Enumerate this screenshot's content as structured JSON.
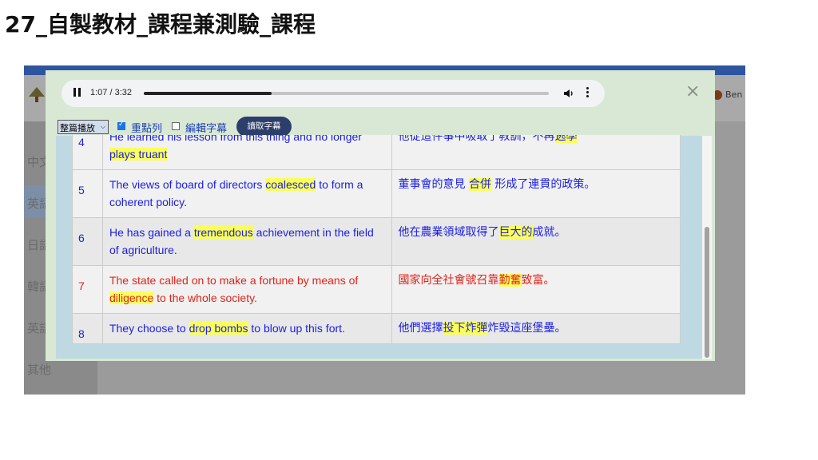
{
  "slide": {
    "title": "27_自製教材_課程兼測驗_課程"
  },
  "sidebar": {
    "items": [
      "中文",
      "英語",
      "日語",
      "韓語",
      "英語",
      "其他"
    ]
  },
  "header": {
    "user": "Ben"
  },
  "audio": {
    "time": "1:07 / 3:32",
    "progress": 0.316
  },
  "controls": {
    "select_value": "整篇播放",
    "repeat_label": "重點列",
    "repeat_checked": true,
    "edit_label": "編輯字幕",
    "edit_checked": false,
    "read_button": "讀取字幕"
  },
  "close_glyph": "×",
  "rows": [
    {
      "num": "4",
      "color": "blue",
      "shade": "b",
      "en": [
        {
          "t": "He learned his lesson from this thing and no longer "
        },
        {
          "t": "plays truant",
          "h": true
        }
      ],
      "zh": [
        {
          "t": "他從這件事中吸取了教訓，不再"
        },
        {
          "t": "逃學",
          "h": true
        }
      ]
    },
    {
      "num": "5",
      "color": "blue",
      "shade": "b",
      "en": [
        {
          "t": "The views of board of directors "
        },
        {
          "t": "coalesced",
          "h": true
        },
        {
          "t": " to form a coherent policy."
        }
      ],
      "zh": [
        {
          "t": "董事會的意見 "
        },
        {
          "t": "合併",
          "h": true
        },
        {
          "t": " 形成了連貫的政策。"
        }
      ]
    },
    {
      "num": "6",
      "color": "blue",
      "shade": "a",
      "en": [
        {
          "t": "He has gained a "
        },
        {
          "t": "tremendous",
          "h": true
        },
        {
          "t": " achievement in the field of agriculture."
        }
      ],
      "zh": [
        {
          "t": "他在農業領域取得了"
        },
        {
          "t": "巨大的",
          "h": true
        },
        {
          "t": "成就。"
        }
      ]
    },
    {
      "num": "7",
      "color": "red",
      "shade": "b",
      "en": [
        {
          "t": "The state called on to make a fortune by means of "
        },
        {
          "t": "diligence",
          "h": true
        },
        {
          "t": " to the whole society."
        }
      ],
      "zh": [
        {
          "t": "國家向全社會號召靠"
        },
        {
          "t": "勤奮",
          "h": true
        },
        {
          "t": "致富。"
        }
      ]
    },
    {
      "num": "8",
      "color": "blue",
      "shade": "a",
      "en": [
        {
          "t": "They choose to "
        },
        {
          "t": "drop bombs",
          "h": true
        },
        {
          "t": " to blow up this fort."
        }
      ],
      "zh": [
        {
          "t": "他們選擇"
        },
        {
          "t": "投下炸彈",
          "h": true
        },
        {
          "t": "炸毀這座堡壘。"
        }
      ]
    }
  ]
}
